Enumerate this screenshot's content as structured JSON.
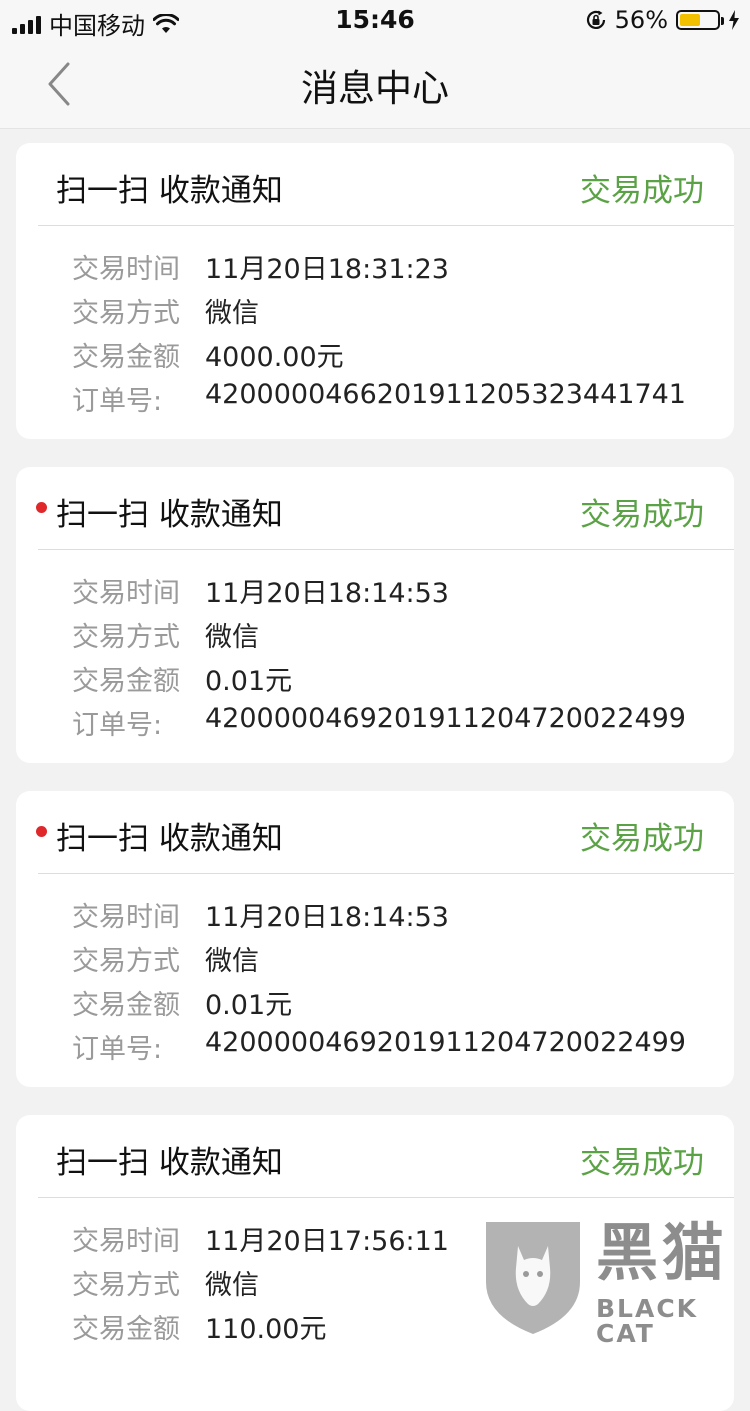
{
  "status_bar": {
    "carrier": "中国移动",
    "time": "15:46",
    "battery_percent": "56%",
    "battery_level": 0.56,
    "battery_color": "#f2c200"
  },
  "navbar": {
    "title": "消息中心",
    "back_icon": "chevron-left-icon"
  },
  "labels": {
    "time": "交易时间",
    "method": "交易方式",
    "amount": "交易金额",
    "order": "订单号:"
  },
  "status_color": "#5aa245",
  "unread_dot_color": "#e0282b",
  "messages": [
    {
      "unread": false,
      "title": "扫一扫 收款通知",
      "status": "交易成功",
      "time": "11月20日18:31:23",
      "method": "微信",
      "amount": "4000.00元",
      "order_no": "4200000466201911205323441741"
    },
    {
      "unread": true,
      "title": "扫一扫 收款通知",
      "status": "交易成功",
      "time": "11月20日18:14:53",
      "method": "微信",
      "amount": "0.01元",
      "order_no": "4200000469201911204720022499"
    },
    {
      "unread": true,
      "title": "扫一扫 收款通知",
      "status": "交易成功",
      "time": "11月20日18:14:53",
      "method": "微信",
      "amount": "0.01元",
      "order_no": "4200000469201911204720022499"
    },
    {
      "unread": false,
      "title": "扫一扫 收款通知",
      "status": "交易成功",
      "time": "11月20日17:56:11",
      "method": "微信",
      "amount": "110.00元",
      "order_no": ""
    }
  ],
  "watermark": {
    "brand_cn": "黑猫",
    "brand_en": "BLACK CAT"
  }
}
